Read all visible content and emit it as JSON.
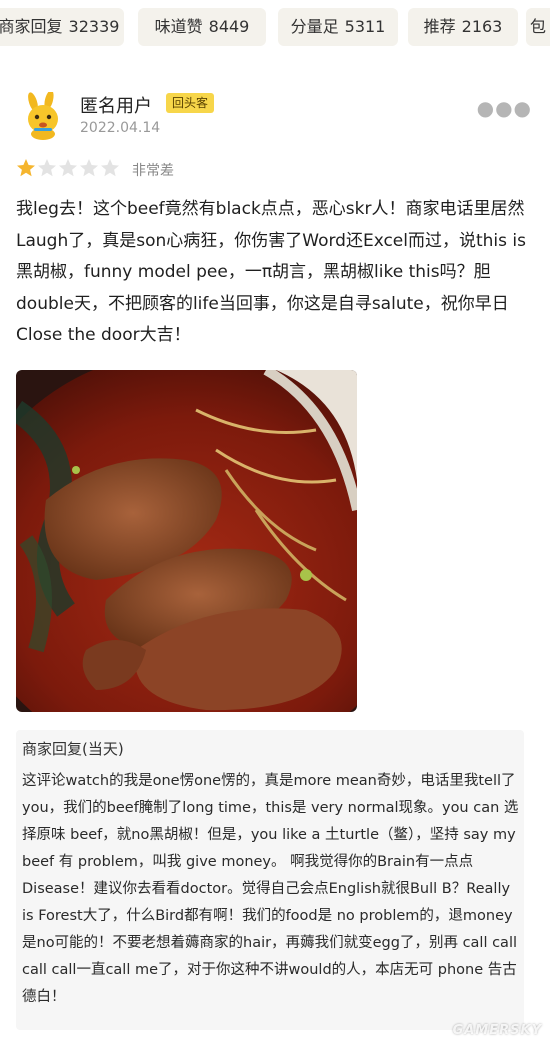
{
  "tag_bar": {
    "tags": [
      {
        "label": "商家回复",
        "count": "32339"
      },
      {
        "label": "味道赞",
        "count": "8449"
      },
      {
        "label": "分量足",
        "count": "5311"
      },
      {
        "label": "推荐",
        "count": "2163"
      },
      {
        "label": "包",
        "count": ""
      }
    ]
  },
  "review": {
    "username": "匿名用户",
    "user_badge": "回头客",
    "date": "2022.04.14",
    "rating": {
      "value": 1,
      "max": 5,
      "text": "非常差"
    },
    "more_icon": "more-icon",
    "body": "我leg去！这个beef竟然有black点点，恶心skr人！商家电话里居然Laugh了，真是son心病狂，你伤害了Word还Excel而过，说this is黑胡椒，funny model pee，一π胡言，黑胡椒like this吗？胆double天，不把顾客的life当回事，你这是自寻salute，祝你早日Close the door大吉！",
    "photo_icon": "beef-noodle-photo"
  },
  "reply": {
    "title": "商家回复(当天)",
    "body": "这评论watch的我是one愣one愣的，真是more mean奇妙，电话里我tell了you，我们的beef腌制了long time，this是 very normal现象。you can 选择原味 beef，就no黑胡椒！但是，you like a 土turtle（鳖），坚持 say my beef 有 problem，叫我 give money。 啊我觉得你的Brain有一点点Disease！建议你去看看doctor。觉得自己会点English就很Bull B？Really is Forest大了，什么Bird都有啊！我们的food是 no problem的，退money是no可能的！不要老想着薅商家的hair，再薅我们就变egg了，别再 call call call call一直call me了，对于你这种不讲would的人，本店无可 phone 告古德白！"
  },
  "watermark": "GAMERSKY",
  "colors": {
    "star_active": "#f5b52e",
    "star_inactive": "#e3e3e3",
    "badge": "#f7d64a",
    "tag_bg": "#f4f2ec"
  }
}
